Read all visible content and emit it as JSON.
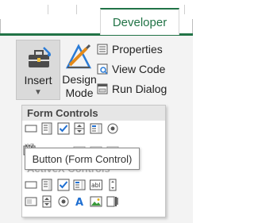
{
  "ribbon": {
    "tabs": [
      {
        "label": "Developer",
        "active": true
      }
    ],
    "insert_button": {
      "label": "Insert",
      "caret": "▼"
    },
    "design_mode_button": {
      "label_line1": "Design",
      "label_line2": "Mode"
    },
    "commands": [
      {
        "label": "Properties",
        "icon": "properties-icon"
      },
      {
        "label": "View Code",
        "icon": "view-code-icon"
      },
      {
        "label": "Run Dialog",
        "icon": "run-dialog-icon"
      }
    ]
  },
  "insert_menu": {
    "form_controls_header": "Form Controls",
    "activex_header": "ActiveX Controls",
    "form_controls": [
      "button-icon",
      "combo-box-icon",
      "check-box-icon",
      "spin-button-icon",
      "list-box-icon",
      "option-button-icon"
    ],
    "form_controls_row2": [
      "group-box-icon",
      "label-icon",
      "scroll-bar-icon",
      "text-field-icon",
      "combo-list-edit-icon",
      "combo-drop-down-edit-icon"
    ],
    "activex_controls": [
      "command-button-icon",
      "combo-box-icon",
      "check-box-icon",
      "list-box-icon",
      "text-box-icon",
      "scroll-bar-icon"
    ],
    "activex_row2": [
      "toggle-button-icon",
      "spin-button-icon",
      "option-button-icon",
      "label-icon",
      "image-icon",
      "more-controls-icon"
    ],
    "tooltip": "Button (Form Control)"
  },
  "colors": {
    "accent_green": "#217346",
    "tab_text": "#217346",
    "check_blue": "#1f6fd1"
  }
}
